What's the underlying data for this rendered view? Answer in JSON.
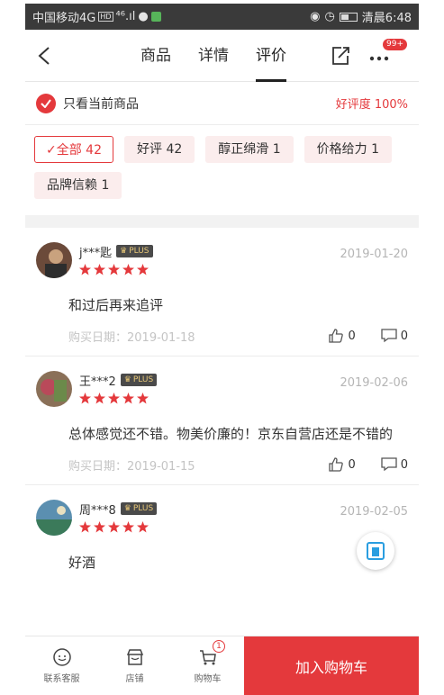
{
  "status_bar": {
    "carrier": "中国移动4G",
    "hd": "HD",
    "signal": "⁴⁶.ıl",
    "time_label": "清晨6:48"
  },
  "nav": {
    "tabs": [
      {
        "label": "商品"
      },
      {
        "label": "详情"
      },
      {
        "label": "评价"
      }
    ],
    "more_badge": "99+"
  },
  "filter": {
    "only_current_label": "只看当前商品",
    "good_rate": "好评度 100%"
  },
  "tags": [
    {
      "label": "✓全部 42",
      "active": true
    },
    {
      "label": "好评 42"
    },
    {
      "label": "醇正绵滑 1"
    },
    {
      "label": "价格给力 1"
    },
    {
      "label": "品牌信赖 1"
    }
  ],
  "reviews": [
    {
      "user": "j***匙",
      "badge": "PLUS",
      "stars": 5,
      "date": "2019-01-20",
      "text": "和过后再来追评",
      "buy_date": "购买日期：2019-01-18",
      "likes": "0",
      "comments": "0"
    },
    {
      "user": "王***2",
      "badge": "PLUS",
      "stars": 5,
      "date": "2019-02-06",
      "text": "总体感觉还不错。物美价廉的！京东自营店还是不错的",
      "buy_date": "购买日期：2019-01-15",
      "likes": "0",
      "comments": "0"
    },
    {
      "user": "周***8",
      "badge": "PLUS",
      "stars": 5,
      "date": "2019-02-05",
      "text": "好酒"
    }
  ],
  "bottom_bar": {
    "service": "联系客服",
    "shop": "店铺",
    "cart": "购物车",
    "cart_count": "1",
    "add_to_cart": "加入购物车"
  },
  "colors": {
    "accent": "#e4393c",
    "tag_bg": "#fbeded",
    "status_bar": "#3a3a3a"
  }
}
